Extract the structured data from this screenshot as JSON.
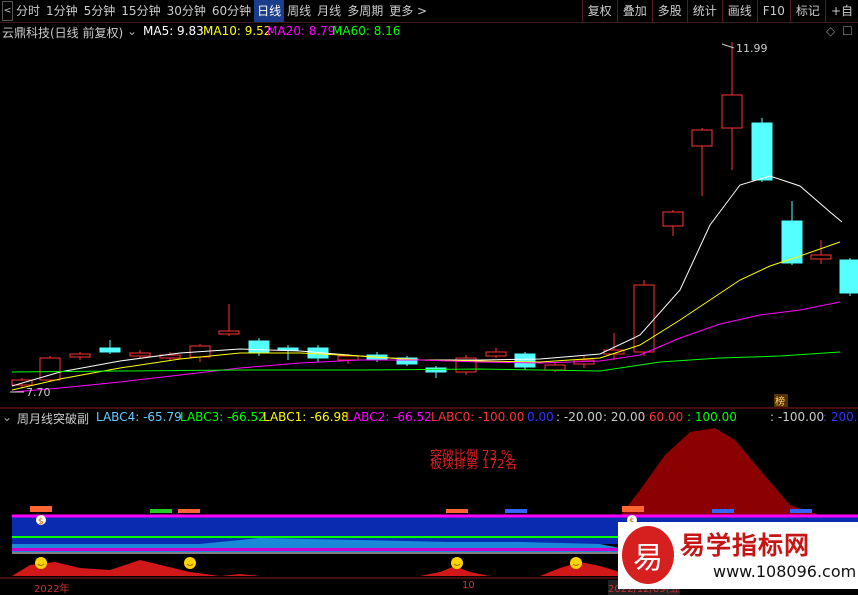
{
  "toolbar": {
    "left_buttons": [
      "<",
      ">"
    ],
    "periods": [
      "分时",
      "1分钟",
      "5分钟",
      "15分钟",
      "30分钟",
      "60分钟",
      "日线",
      "周线",
      "月线",
      "多周期",
      "更多 >"
    ],
    "active_period": "日线",
    "right_items": [
      "复权",
      "叠加",
      "多股",
      "统计",
      "画线",
      "F10",
      "标记",
      "+自"
    ]
  },
  "main_title": {
    "stock": "云鼎科技(日线 前复权)",
    "ma5": "MA5: 9.83",
    "ma10": "MA10: 9.52",
    "ma20": "MA20: 8.79",
    "ma60": "MA60: 8.16",
    "colors": {
      "ma5": "#ffffff",
      "ma10": "#ffff00",
      "ma20": "#ff00ff",
      "ma60": "#00ff00"
    }
  },
  "price_labels": {
    "high": "11.99",
    "low": "7.70"
  },
  "badge": "榜",
  "sub_title": {
    "name": "周月线突破副",
    "labc4": "LABC4: -65.79",
    "labc3": "LABC3: -66.52",
    "labc1": "LABC1: -66.98",
    "labc2": "LABC2: -66.52",
    "labc0": "LABC0: -100.00",
    "v1": "0.00",
    "v2": ": -20.00",
    "v3": ": 20.00",
    "v4": ": 60.00",
    "v5": ": 100.00",
    "v6": ": -100.00",
    "v7": ": 200.0"
  },
  "sub_text": {
    "line1": "突破比例 73 %",
    "line2": "板块排第 172名"
  },
  "bottom_axis": [
    "2022年",
    "10",
    "2022/12/09(五"
  ],
  "watermark": {
    "logo": "易",
    "title": "易学指标网",
    "url": "www.108096.com"
  },
  "chart_data": {
    "type": "candlestick",
    "series_ma": [
      "MA5",
      "MA10",
      "MA20",
      "MA60"
    ],
    "high_label": 11.99,
    "low_label": 7.7
  }
}
